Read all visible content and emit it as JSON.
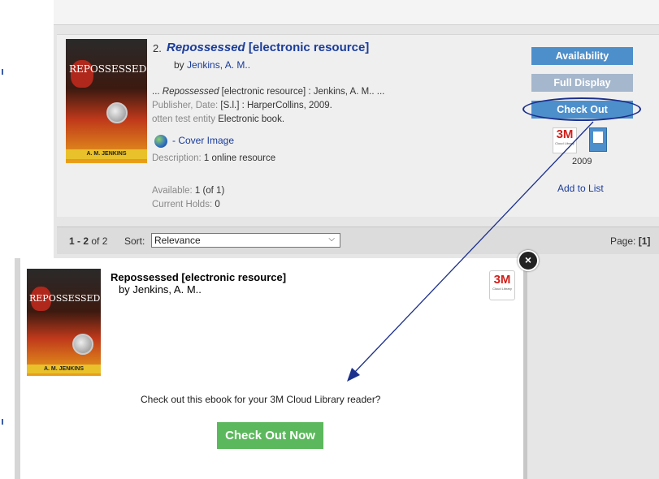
{
  "result": {
    "number": "2.",
    "title_italic": "Repossessed",
    "title_suffix": " [electronic resource]",
    "by_prefix": "by ",
    "author": "Jenkins, A. M..",
    "snippet_prefix": "... ",
    "snippet_italic": "Repossessed",
    "snippet_rest": " [electronic resource] : Jenkins, A. M.. ...",
    "publisher_label": "Publisher, Date:",
    "publisher_value": " [S.l.] : HarperCollins, 2009.",
    "format_label": "otten test entity",
    "format_value": " Electronic book.",
    "cover_link": "- Cover Image",
    "description_label": "Description:",
    "description_value": " 1 online resource",
    "available_label": "Available:",
    "available_value": " 1 (of 1)",
    "holds_label": "Current Holds:",
    "holds_value": " 0",
    "year": "2009",
    "add_to_list": "Add to List",
    "cover_title": "REPOSSESSED",
    "cover_author": "A. M. JENKINS"
  },
  "buttons": {
    "availability": "Availability",
    "full_display": "Full Display",
    "check_out": "Check Out"
  },
  "pager": {
    "range_bold": "1 - 2",
    "range_of": " of 2",
    "sort_label": "Sort:",
    "sort_value": "Relevance",
    "page_label": "Page:",
    "page_value": "[1]"
  },
  "modal": {
    "title": "Repossessed [electronic resource]",
    "author_line": "by Jenkins, A. M..",
    "prompt": "Check out this ebook for your 3M Cloud Library reader?",
    "button": "Check Out Now",
    "close": "×"
  },
  "logo": {
    "mark": "3M",
    "sub": "Cloud Library"
  },
  "colors": {
    "link": "#1a3c9a",
    "button_blue": "#4d8fcb",
    "button_disabled": "#a5b7cc",
    "check_out_now": "#5cb85c",
    "annotation": "#1b2f8c"
  }
}
